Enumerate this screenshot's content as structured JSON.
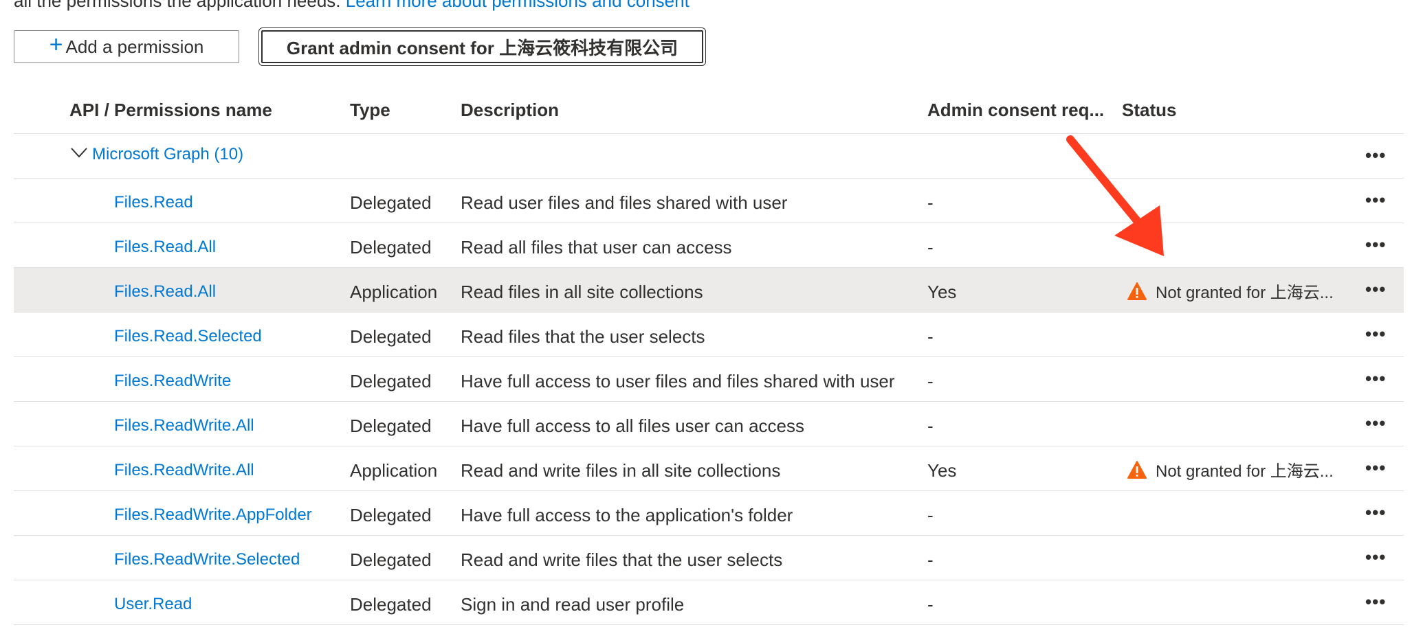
{
  "intro": {
    "text": "all the permissions the application needs.",
    "link": "Learn more about permissions and consent"
  },
  "toolbar": {
    "add_label": "Add a permission",
    "grant_label": "Grant admin consent for 上海云筱科技有限公司"
  },
  "columns": {
    "name": "API / Permissions name",
    "type": "Type",
    "description": "Description",
    "admin": "Admin consent req...",
    "status": "Status"
  },
  "group": {
    "label": "Microsoft Graph (10)"
  },
  "more_glyph": "•••",
  "rows": [
    {
      "name": "Files.Read",
      "type": "Delegated",
      "description": "Read user files and files shared with user",
      "admin": "-",
      "status": ""
    },
    {
      "name": "Files.Read.All",
      "type": "Delegated",
      "description": "Read all files that user can access",
      "admin": "-",
      "status": ""
    },
    {
      "name": "Files.Read.All",
      "type": "Application",
      "description": "Read files in all site collections",
      "admin": "Yes",
      "status": "Not granted for 上海云..."
    },
    {
      "name": "Files.Read.Selected",
      "type": "Delegated",
      "description": "Read files that the user selects",
      "admin": "-",
      "status": ""
    },
    {
      "name": "Files.ReadWrite",
      "type": "Delegated",
      "description": "Have full access to user files and files shared with user",
      "admin": "-",
      "status": ""
    },
    {
      "name": "Files.ReadWrite.All",
      "type": "Delegated",
      "description": "Have full access to all files user can access",
      "admin": "-",
      "status": ""
    },
    {
      "name": "Files.ReadWrite.All",
      "type": "Application",
      "description": "Read and write files in all site collections",
      "admin": "Yes",
      "status": "Not granted for 上海云..."
    },
    {
      "name": "Files.ReadWrite.AppFolder",
      "type": "Delegated",
      "description": "Have full access to the application's folder",
      "admin": "-",
      "status": ""
    },
    {
      "name": "Files.ReadWrite.Selected",
      "type": "Delegated",
      "description": "Read and write files that the user selects",
      "admin": "-",
      "status": ""
    },
    {
      "name": "User.Read",
      "type": "Delegated",
      "description": "Sign in and read user profile",
      "admin": "-",
      "status": ""
    }
  ],
  "colors": {
    "link": "#0078d4",
    "warning": "#f7630c",
    "annotation_arrow": "#ff3b1f",
    "row_highlight": "#edebe9"
  }
}
